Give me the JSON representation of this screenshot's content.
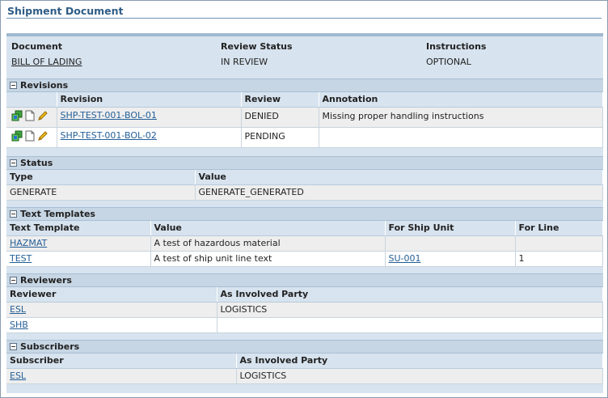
{
  "page": {
    "title": "Shipment Document"
  },
  "document_header": {
    "columns": [
      {
        "label": "Document",
        "value": "BILL OF LADING"
      },
      {
        "label": "Review Status",
        "value": "IN REVIEW"
      },
      {
        "label": "Instructions",
        "value": "OPTIONAL"
      }
    ]
  },
  "revisions": {
    "title": "Revisions",
    "headers": [
      "Revision",
      "Review",
      "Annotation"
    ],
    "rows": [
      {
        "revision": "SHP-TEST-001-BOL-01",
        "review": "DENIED",
        "annotation": "Missing proper handling instructions"
      },
      {
        "revision": "SHP-TEST-001-BOL-02",
        "review": "PENDING",
        "annotation": ""
      }
    ],
    "row_icons": [
      "copy-icon",
      "document-icon",
      "pencil-icon"
    ]
  },
  "status": {
    "title": "Status",
    "headers": [
      "Type",
      "Value"
    ],
    "rows": [
      {
        "type": "GENERATE",
        "value": "GENERATE_GENERATED"
      }
    ]
  },
  "text_templates": {
    "title": "Text Templates",
    "headers": [
      "Text Template",
      "Value",
      "For Ship Unit",
      "For Line"
    ],
    "rows": [
      {
        "template": "HAZMAT",
        "value": "A test of hazardous material",
        "ship_unit": "",
        "line": ""
      },
      {
        "template": "TEST",
        "value": "A test of ship unit line text",
        "ship_unit": "SU-001",
        "line": "1"
      }
    ]
  },
  "reviewers": {
    "title": "Reviewers",
    "headers": [
      "Reviewer",
      "As Involved Party"
    ],
    "rows": [
      {
        "reviewer": "ESL",
        "party": "LOGISTICS"
      },
      {
        "reviewer": "SHB",
        "party": ""
      }
    ]
  },
  "subscribers": {
    "title": "Subscribers",
    "headers": [
      "Subscriber",
      "As Involved Party"
    ],
    "rows": [
      {
        "subscriber": "ESL",
        "party": "LOGISTICS"
      }
    ]
  },
  "colors": {
    "link": "#245f96",
    "title": "#2f5d86",
    "panel": "#d7e3ee",
    "section_bar": "#c7d6e4",
    "odd_row": "#eeeeee"
  }
}
